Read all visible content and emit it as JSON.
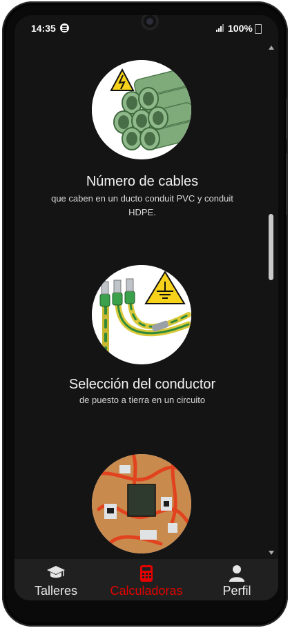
{
  "status": {
    "time": "14:35",
    "battery": "100%"
  },
  "cards": [
    {
      "title": "Número de cables",
      "subtitle": "que caben en un ducto conduit PVC y conduit HDPE.",
      "image": "pvc-conduit-pipes-with-electric-warning"
    },
    {
      "title": "Selección del conductor",
      "subtitle": "de puesto a tierra en un circuito",
      "image": "ground-conductor-wires-with-earth-symbol"
    },
    {
      "title": "",
      "subtitle": "",
      "image": "electrical-panel-wiring-board"
    }
  ],
  "nav": {
    "items": [
      {
        "label": "Talleres",
        "icon": "graduation-cap-icon"
      },
      {
        "label": "Calculadoras",
        "icon": "calculator-icon",
        "active": true
      },
      {
        "label": "Perfil",
        "icon": "user-icon"
      }
    ]
  },
  "colors": {
    "accent": "#e50000",
    "background": "#141414",
    "navbar": "#202020"
  }
}
